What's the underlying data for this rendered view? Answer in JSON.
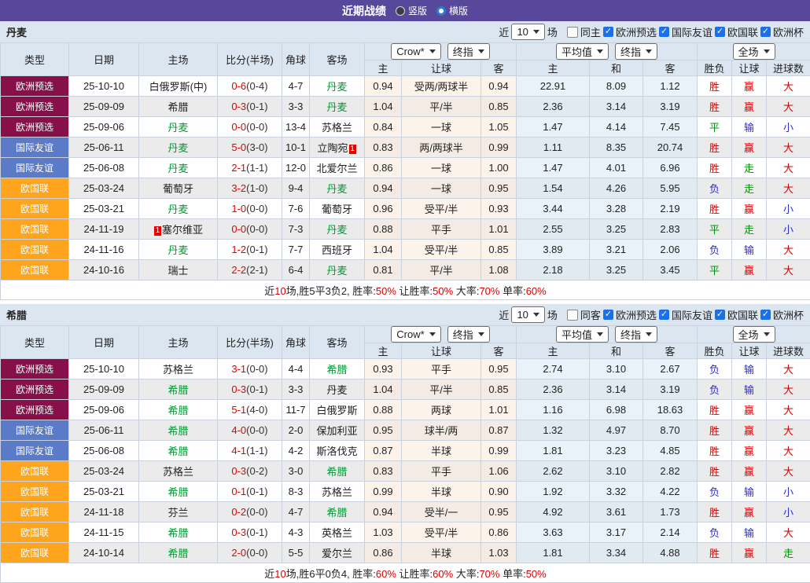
{
  "topbar": {
    "title": "近期战绩",
    "layout_options": [
      {
        "label": "竖版",
        "selected": false
      },
      {
        "label": "横版",
        "selected": true
      }
    ]
  },
  "filter_labels": {
    "near": "近",
    "count": "10",
    "games": "场",
    "competitions": [
      "欧洲预选",
      "国际友谊",
      "欧国联",
      "欧洲杯"
    ]
  },
  "columns": {
    "main": [
      "类型",
      "日期",
      "主场",
      "比分(半场)",
      "角球",
      "客场"
    ],
    "dropdowns": [
      "Crow*",
      "终指",
      "平均值",
      "终指",
      "全场"
    ],
    "sub": [
      "主",
      "让球",
      "客",
      "主",
      "和",
      "客",
      "胜负",
      "让球",
      "进球数"
    ]
  },
  "type_colors": {
    "欧洲预选": "#870f4a",
    "国际友谊": "#5b7ac8",
    "欧国联": "#ffa41d"
  },
  "word_colors": {
    "胜": "red",
    "赢": "red",
    "大": "red",
    "平": "green",
    "走": "green",
    "负": "blue",
    "输": "blue",
    "小": "blue"
  },
  "palette": {
    "topbar": "#57489c",
    "header_bg": "#dce6f1",
    "team_green": "#009933",
    "score_red": "#e60000",
    "crow_bg": "#fcf3ea",
    "avg_bg": "#e9f2f9"
  },
  "sections": [
    {
      "team": "丹麦",
      "same_label": "同主",
      "rows": [
        {
          "type": "欧洲预选",
          "date": "25-10-10",
          "home": "白俄罗斯(中)",
          "home_is_team": false,
          "home_mark_pre": "",
          "home_mark_post": "",
          "score_ft": "0-6",
          "score_ht": "(0-4)",
          "corners": "4-7",
          "away": "丹麦",
          "away_is_team": true,
          "away_mark_pre": "",
          "away_mark_post": "",
          "crow_home": "0.94",
          "handicap": "受两/两球半",
          "crow_away": "0.94",
          "avg_home": "22.91",
          "avg_draw": "8.09",
          "avg_away": "1.12",
          "outcome": "胜",
          "handicap_result": "赢",
          "goals_result": "大"
        },
        {
          "type": "欧洲预选",
          "date": "25-09-09",
          "home": "希腊",
          "home_is_team": false,
          "home_mark_pre": "",
          "home_mark_post": "",
          "score_ft": "0-3",
          "score_ht": "(0-1)",
          "corners": "3-3",
          "away": "丹麦",
          "away_is_team": true,
          "away_mark_pre": "",
          "away_mark_post": "",
          "crow_home": "1.04",
          "handicap": "平/半",
          "crow_away": "0.85",
          "avg_home": "2.36",
          "avg_draw": "3.14",
          "avg_away": "3.19",
          "outcome": "胜",
          "handicap_result": "赢",
          "goals_result": "大"
        },
        {
          "type": "欧洲预选",
          "date": "25-09-06",
          "home": "丹麦",
          "home_is_team": true,
          "home_mark_pre": "",
          "home_mark_post": "",
          "score_ft": "0-0",
          "score_ht": "(0-0)",
          "corners": "13-4",
          "away": "苏格兰",
          "away_is_team": false,
          "away_mark_pre": "",
          "away_mark_post": "",
          "crow_home": "0.84",
          "handicap": "一球",
          "crow_away": "1.05",
          "avg_home": "1.47",
          "avg_draw": "4.14",
          "avg_away": "7.45",
          "outcome": "平",
          "handicap_result": "输",
          "goals_result": "小"
        },
        {
          "type": "国际友谊",
          "date": "25-06-11",
          "home": "丹麦",
          "home_is_team": true,
          "home_mark_pre": "",
          "home_mark_post": "",
          "score_ft": "5-0",
          "score_ht": "(3-0)",
          "corners": "10-1",
          "away": "立陶宛",
          "away_is_team": false,
          "away_mark_pre": "",
          "away_mark_post": "1",
          "crow_home": "0.83",
          "handicap": "两/两球半",
          "crow_away": "0.99",
          "avg_home": "1.11",
          "avg_draw": "8.35",
          "avg_away": "20.74",
          "outcome": "胜",
          "handicap_result": "赢",
          "goals_result": "大"
        },
        {
          "type": "国际友谊",
          "date": "25-06-08",
          "home": "丹麦",
          "home_is_team": true,
          "home_mark_pre": "",
          "home_mark_post": "",
          "score_ft": "2-1",
          "score_ht": "(1-1)",
          "corners": "12-0",
          "away": "北爱尔兰",
          "away_is_team": false,
          "away_mark_pre": "",
          "away_mark_post": "",
          "crow_home": "0.86",
          "handicap": "一球",
          "crow_away": "1.00",
          "avg_home": "1.47",
          "avg_draw": "4.01",
          "avg_away": "6.96",
          "outcome": "胜",
          "handicap_result": "走",
          "goals_result": "大"
        },
        {
          "type": "欧国联",
          "date": "25-03-24",
          "home": "葡萄牙",
          "home_is_team": false,
          "home_mark_pre": "",
          "home_mark_post": "",
          "score_ft": "3-2",
          "score_ht": "(1-0)",
          "corners": "9-4",
          "away": "丹麦",
          "away_is_team": true,
          "away_mark_pre": "",
          "away_mark_post": "",
          "crow_home": "0.94",
          "handicap": "一球",
          "crow_away": "0.95",
          "avg_home": "1.54",
          "avg_draw": "4.26",
          "avg_away": "5.95",
          "outcome": "负",
          "handicap_result": "走",
          "goals_result": "大"
        },
        {
          "type": "欧国联",
          "date": "25-03-21",
          "home": "丹麦",
          "home_is_team": true,
          "home_mark_pre": "",
          "home_mark_post": "",
          "score_ft": "1-0",
          "score_ht": "(0-0)",
          "corners": "7-6",
          "away": "葡萄牙",
          "away_is_team": false,
          "away_mark_pre": "",
          "away_mark_post": "",
          "crow_home": "0.96",
          "handicap": "受平/半",
          "crow_away": "0.93",
          "avg_home": "3.44",
          "avg_draw": "3.28",
          "avg_away": "2.19",
          "outcome": "胜",
          "handicap_result": "赢",
          "goals_result": "小"
        },
        {
          "type": "欧国联",
          "date": "24-11-19",
          "home": "塞尔维亚",
          "home_is_team": false,
          "home_mark_pre": "1",
          "home_mark_post": "",
          "score_ft": "0-0",
          "score_ht": "(0-0)",
          "corners": "7-3",
          "away": "丹麦",
          "away_is_team": true,
          "away_mark_pre": "",
          "away_mark_post": "",
          "crow_home": "0.88",
          "handicap": "平手",
          "crow_away": "1.01",
          "avg_home": "2.55",
          "avg_draw": "3.25",
          "avg_away": "2.83",
          "outcome": "平",
          "handicap_result": "走",
          "goals_result": "小"
        },
        {
          "type": "欧国联",
          "date": "24-11-16",
          "home": "丹麦",
          "home_is_team": true,
          "home_mark_pre": "",
          "home_mark_post": "",
          "score_ft": "1-2",
          "score_ht": "(0-1)",
          "corners": "7-7",
          "away": "西班牙",
          "away_is_team": false,
          "away_mark_pre": "",
          "away_mark_post": "",
          "crow_home": "1.04",
          "handicap": "受平/半",
          "crow_away": "0.85",
          "avg_home": "3.89",
          "avg_draw": "3.21",
          "avg_away": "2.06",
          "outcome": "负",
          "handicap_result": "输",
          "goals_result": "大"
        },
        {
          "type": "欧国联",
          "date": "24-10-16",
          "home": "瑞士",
          "home_is_team": false,
          "home_mark_pre": "",
          "home_mark_post": "",
          "score_ft": "2-2",
          "score_ht": "(2-1)",
          "corners": "6-4",
          "away": "丹麦",
          "away_is_team": true,
          "away_mark_pre": "",
          "away_mark_post": "",
          "crow_home": "0.81",
          "handicap": "平/半",
          "crow_away": "1.08",
          "avg_home": "2.18",
          "avg_draw": "3.25",
          "avg_away": "3.45",
          "outcome": "平",
          "handicap_result": "赢",
          "goals_result": "大"
        }
      ],
      "summary": [
        [
          "近",
          ""
        ],
        [
          "10",
          "r"
        ],
        [
          "场,胜5平3负2, 胜率:",
          ""
        ],
        [
          "50%",
          "r"
        ],
        [
          " 让胜率:",
          ""
        ],
        [
          "50%",
          "r"
        ],
        [
          " 大率:",
          ""
        ],
        [
          "70%",
          "r"
        ],
        [
          " 单率:",
          ""
        ],
        [
          "60%",
          "r"
        ]
      ]
    },
    {
      "team": "希腊",
      "same_label": "同客",
      "rows": [
        {
          "type": "欧洲预选",
          "date": "25-10-10",
          "home": "苏格兰",
          "home_is_team": false,
          "home_mark_pre": "",
          "home_mark_post": "",
          "score_ft": "3-1",
          "score_ht": "(0-0)",
          "corners": "4-4",
          "away": "希腊",
          "away_is_team": true,
          "away_mark_pre": "",
          "away_mark_post": "",
          "crow_home": "0.93",
          "handicap": "平手",
          "crow_away": "0.95",
          "avg_home": "2.74",
          "avg_draw": "3.10",
          "avg_away": "2.67",
          "outcome": "负",
          "handicap_result": "输",
          "goals_result": "大"
        },
        {
          "type": "欧洲预选",
          "date": "25-09-09",
          "home": "希腊",
          "home_is_team": true,
          "home_mark_pre": "",
          "home_mark_post": "",
          "score_ft": "0-3",
          "score_ht": "(0-1)",
          "corners": "3-3",
          "away": "丹麦",
          "away_is_team": false,
          "away_mark_pre": "",
          "away_mark_post": "",
          "crow_home": "1.04",
          "handicap": "平/半",
          "crow_away": "0.85",
          "avg_home": "2.36",
          "avg_draw": "3.14",
          "avg_away": "3.19",
          "outcome": "负",
          "handicap_result": "输",
          "goals_result": "大"
        },
        {
          "type": "欧洲预选",
          "date": "25-09-06",
          "home": "希腊",
          "home_is_team": true,
          "home_mark_pre": "",
          "home_mark_post": "",
          "score_ft": "5-1",
          "score_ht": "(4-0)",
          "corners": "11-7",
          "away": "白俄罗斯",
          "away_is_team": false,
          "away_mark_pre": "",
          "away_mark_post": "",
          "crow_home": "0.88",
          "handicap": "两球",
          "crow_away": "1.01",
          "avg_home": "1.16",
          "avg_draw": "6.98",
          "avg_away": "18.63",
          "outcome": "胜",
          "handicap_result": "赢",
          "goals_result": "大"
        },
        {
          "type": "国际友谊",
          "date": "25-06-11",
          "home": "希腊",
          "home_is_team": true,
          "home_mark_pre": "",
          "home_mark_post": "",
          "score_ft": "4-0",
          "score_ht": "(0-0)",
          "corners": "2-0",
          "away": "保加利亚",
          "away_is_team": false,
          "away_mark_pre": "",
          "away_mark_post": "",
          "crow_home": "0.95",
          "handicap": "球半/两",
          "crow_away": "0.87",
          "avg_home": "1.32",
          "avg_draw": "4.97",
          "avg_away": "8.70",
          "outcome": "胜",
          "handicap_result": "赢",
          "goals_result": "大"
        },
        {
          "type": "国际友谊",
          "date": "25-06-08",
          "home": "希腊",
          "home_is_team": true,
          "home_mark_pre": "",
          "home_mark_post": "",
          "score_ft": "4-1",
          "score_ht": "(1-1)",
          "corners": "4-2",
          "away": "斯洛伐克",
          "away_is_team": false,
          "away_mark_pre": "",
          "away_mark_post": "",
          "crow_home": "0.87",
          "handicap": "半球",
          "crow_away": "0.99",
          "avg_home": "1.81",
          "avg_draw": "3.23",
          "avg_away": "4.85",
          "outcome": "胜",
          "handicap_result": "赢",
          "goals_result": "大"
        },
        {
          "type": "欧国联",
          "date": "25-03-24",
          "home": "苏格兰",
          "home_is_team": false,
          "home_mark_pre": "",
          "home_mark_post": "",
          "score_ft": "0-3",
          "score_ht": "(0-2)",
          "corners": "3-0",
          "away": "希腊",
          "away_is_team": true,
          "away_mark_pre": "",
          "away_mark_post": "",
          "crow_home": "0.83",
          "handicap": "平手",
          "crow_away": "1.06",
          "avg_home": "2.62",
          "avg_draw": "3.10",
          "avg_away": "2.82",
          "outcome": "胜",
          "handicap_result": "赢",
          "goals_result": "大"
        },
        {
          "type": "欧国联",
          "date": "25-03-21",
          "home": "希腊",
          "home_is_team": true,
          "home_mark_pre": "",
          "home_mark_post": "",
          "score_ft": "0-1",
          "score_ht": "(0-1)",
          "corners": "8-3",
          "away": "苏格兰",
          "away_is_team": false,
          "away_mark_pre": "",
          "away_mark_post": "",
          "crow_home": "0.99",
          "handicap": "半球",
          "crow_away": "0.90",
          "avg_home": "1.92",
          "avg_draw": "3.32",
          "avg_away": "4.22",
          "outcome": "负",
          "handicap_result": "输",
          "goals_result": "小"
        },
        {
          "type": "欧国联",
          "date": "24-11-18",
          "home": "芬兰",
          "home_is_team": false,
          "home_mark_pre": "",
          "home_mark_post": "",
          "score_ft": "0-2",
          "score_ht": "(0-0)",
          "corners": "4-7",
          "away": "希腊",
          "away_is_team": true,
          "away_mark_pre": "",
          "away_mark_post": "",
          "crow_home": "0.94",
          "handicap": "受半/一",
          "crow_away": "0.95",
          "avg_home": "4.92",
          "avg_draw": "3.61",
          "avg_away": "1.73",
          "outcome": "胜",
          "handicap_result": "赢",
          "goals_result": "小"
        },
        {
          "type": "欧国联",
          "date": "24-11-15",
          "home": "希腊",
          "home_is_team": true,
          "home_mark_pre": "",
          "home_mark_post": "",
          "score_ft": "0-3",
          "score_ht": "(0-1)",
          "corners": "4-3",
          "away": "英格兰",
          "away_is_team": false,
          "away_mark_pre": "",
          "away_mark_post": "",
          "crow_home": "1.03",
          "handicap": "受平/半",
          "crow_away": "0.86",
          "avg_home": "3.63",
          "avg_draw": "3.17",
          "avg_away": "2.14",
          "outcome": "负",
          "handicap_result": "输",
          "goals_result": "大"
        },
        {
          "type": "欧国联",
          "date": "24-10-14",
          "home": "希腊",
          "home_is_team": true,
          "home_mark_pre": "",
          "home_mark_post": "",
          "score_ft": "2-0",
          "score_ht": "(0-0)",
          "corners": "5-5",
          "away": "爱尔兰",
          "away_is_team": false,
          "away_mark_pre": "",
          "away_mark_post": "",
          "crow_home": "0.86",
          "handicap": "半球",
          "crow_away": "1.03",
          "avg_home": "1.81",
          "avg_draw": "3.34",
          "avg_away": "4.88",
          "outcome": "胜",
          "handicap_result": "赢",
          "goals_result": "走"
        }
      ],
      "summary": [
        [
          "近",
          ""
        ],
        [
          "10",
          "r"
        ],
        [
          "场,胜6平0负4, 胜率:",
          ""
        ],
        [
          "60%",
          "r"
        ],
        [
          " 让胜率:",
          ""
        ],
        [
          "60%",
          "r"
        ],
        [
          " 大率:",
          ""
        ],
        [
          "70%",
          "r"
        ],
        [
          " 单率:",
          ""
        ],
        [
          "50%",
          "r"
        ]
      ]
    }
  ]
}
